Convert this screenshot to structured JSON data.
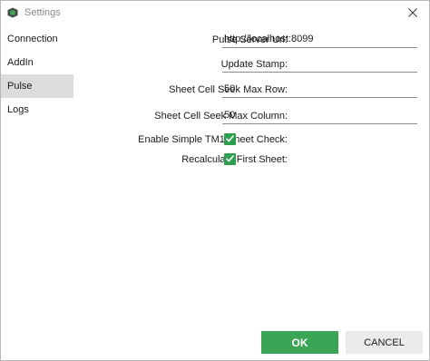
{
  "window": {
    "title": "Settings"
  },
  "sidebar": {
    "items": [
      {
        "label": "Connection",
        "selected": false
      },
      {
        "label": "AddIn",
        "selected": false
      },
      {
        "label": "Pulse",
        "selected": true
      },
      {
        "label": "Logs",
        "selected": false
      }
    ]
  },
  "form": {
    "pulse_server_url": {
      "label": "Pulse Server Url:",
      "value": "http://localhost:8099"
    },
    "update_stamp": {
      "label": "Update Stamp:",
      "value": ""
    },
    "sheet_cell_seek_max_row": {
      "label": "Sheet Cell Seek Max Row:",
      "value": "50"
    },
    "sheet_cell_seek_max_column": {
      "label": "Sheet Cell Seek Max Column:",
      "value": "50"
    },
    "enable_simple_tm1_sheet_check": {
      "label": "Enable Simple TM1 Sheet Check:",
      "checked": true
    },
    "recalculate_first_sheet": {
      "label": "Recalculate First Sheet:",
      "checked": true
    }
  },
  "buttons": {
    "ok_label": "OK",
    "cancel_label": "CANCEL"
  },
  "colors": {
    "accent_green": "#3aa655",
    "checkbox_green": "#2e9e4f",
    "selected_item_bg": "#dcdcdc"
  },
  "icons": {
    "app": "app-icon",
    "close": "close-icon",
    "check": "check-icon"
  }
}
